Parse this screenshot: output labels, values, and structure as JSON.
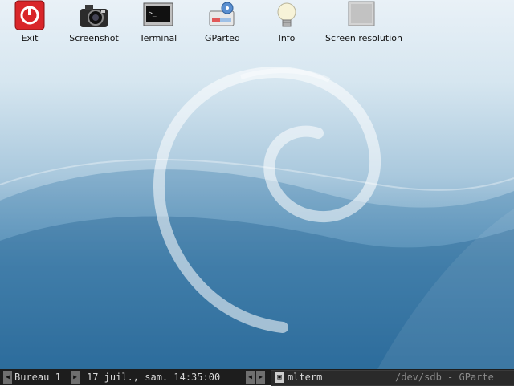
{
  "desktop_icons": [
    {
      "icon": "exit-icon",
      "label": "Exit"
    },
    {
      "icon": "camera-icon",
      "label": "Screenshot"
    },
    {
      "icon": "terminal-icon",
      "label": "Terminal"
    },
    {
      "icon": "gparted-icon",
      "label": "GParted"
    },
    {
      "icon": "lightbulb-icon",
      "label": "Info"
    },
    {
      "icon": "monitor-icon",
      "label": "Screen resolution"
    }
  ],
  "taskbar": {
    "workspace": "Bureau 1",
    "clock": "17 juil., sam. 14:35:00",
    "task_active": "mlterm",
    "task_other": "/dev/sdb - GParte"
  },
  "colors": {
    "taskbar_bg": "#1d1d1d",
    "exit_red": "#d9262a",
    "wallpaper_top": "#e9f1f7",
    "wallpaper_bottom": "#2f6f9f"
  }
}
